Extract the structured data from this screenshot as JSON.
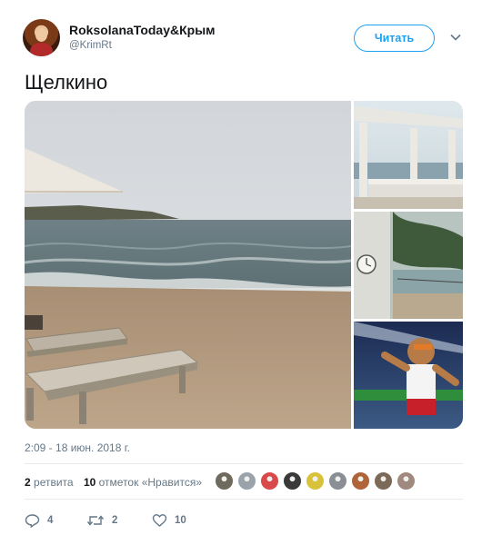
{
  "author": {
    "display_name": "RoksolanaToday&Крым",
    "handle": "@KrimRt"
  },
  "follow_button": {
    "label": "Читать"
  },
  "tweet": {
    "text": "Щелкино",
    "timestamp": "2:09 - 18 июн. 2018 г."
  },
  "stats": {
    "retweets_count": "2",
    "retweets_label": "ретвита",
    "likes_count": "10",
    "likes_label": "отметок «Нравится»"
  },
  "likers": [
    {
      "color": "#6f6a5e"
    },
    {
      "color": "#9aa3ab"
    },
    {
      "color": "#d94a4a"
    },
    {
      "color": "#3a3a3a"
    },
    {
      "color": "#d8c23a"
    },
    {
      "color": "#8a8f95"
    },
    {
      "color": "#b0643a"
    },
    {
      "color": "#7b6a58"
    },
    {
      "color": "#a08a80"
    }
  ],
  "actions": {
    "reply_count": "4",
    "retweet_count": "2",
    "like_count": "10"
  },
  "colors": {
    "accent": "#1da1f2",
    "secondary_text": "#657786",
    "border": "#e6ecf0"
  }
}
